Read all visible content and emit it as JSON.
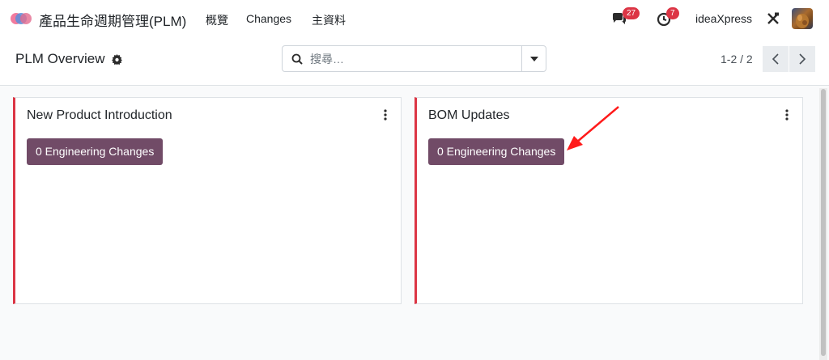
{
  "navbar": {
    "app_title": "產品生命週期管理(PLM)",
    "menus": [
      {
        "label": "概覽"
      },
      {
        "label": "Changes"
      },
      {
        "label": "主資料"
      }
    ],
    "messages_badge": "27",
    "activities_badge": "7",
    "company": "ideaXpress"
  },
  "control": {
    "breadcrumb": "PLM Overview",
    "search_placeholder": "搜尋…",
    "pager": "1-2 / 2"
  },
  "cards": [
    {
      "title": "New Product Introduction",
      "button": "0 Engineering Changes"
    },
    {
      "title": "BOM Updates",
      "button": "0 Engineering Changes"
    }
  ],
  "colors": {
    "accent": "#714b67",
    "stripe": "#dc3545",
    "badge": "#dc3545",
    "annotation_arrow": "#ff1a1a"
  }
}
